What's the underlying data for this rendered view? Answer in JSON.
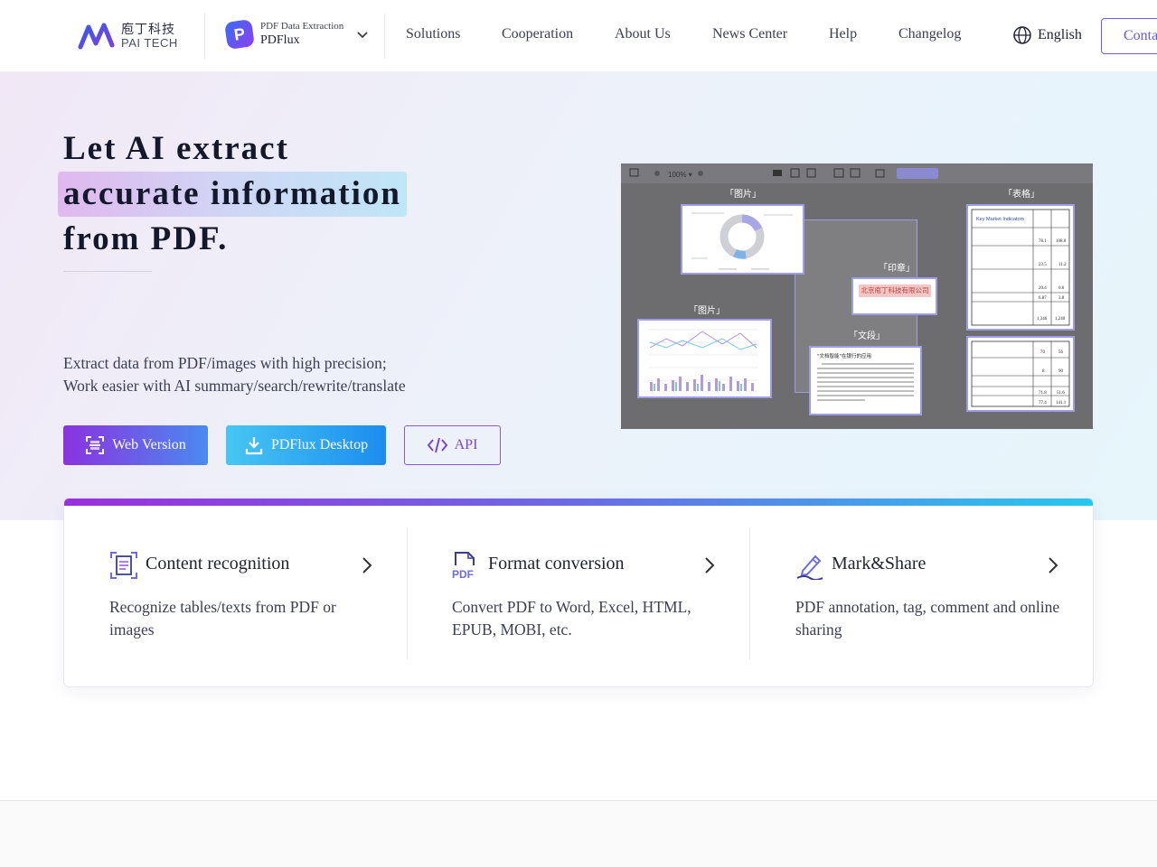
{
  "header": {
    "logo_cn": "庖丁科技",
    "logo_en": "PAI TECH",
    "product_badge": "P",
    "product_sub": "PDF Data Extraction",
    "product_name": "PDFlux",
    "nav": [
      "Solutions",
      "Cooperation",
      "About Us",
      "News Center",
      "Help",
      "Changelog"
    ],
    "language": "English",
    "contact": "Conta"
  },
  "hero": {
    "headline_1": "Let AI extract",
    "headline_2": "accurate information",
    "headline_3": "from PDF.",
    "desc_1": "Extract data from PDF/images with high precision;",
    "desc_2": "Work easier with AI summary/search/rewrite/translate",
    "btn_web": "Web Version",
    "btn_desktop": "PDFlux Desktop",
    "btn_api": "API"
  },
  "preview": {
    "zoom": "100%",
    "label_image_top": "「图片」",
    "label_table": "「表格」",
    "label_seal": "「印章」",
    "label_image_left": "「图片」",
    "label_paragraph": "「文段」",
    "seal_text": "北京庖丁科技有限公司",
    "table_title": "Key Market Indicators",
    "paragraph_title": "\"文档智能\"在银行的应用"
  },
  "features": [
    {
      "title": "Content recognition",
      "desc": "Recognize tables/texts from PDF or images"
    },
    {
      "title": "Format conversion",
      "desc": "Convert PDF to Word, Excel, HTML, EPUB, MOBI, etc."
    },
    {
      "title": "Mark&Share",
      "desc": "PDF annotation, tag, comment and online sharing"
    }
  ],
  "colors": {
    "accent_purple": "#6b5bd6",
    "gradient_start": "#9b2fdd",
    "gradient_end": "#26c8ef"
  }
}
